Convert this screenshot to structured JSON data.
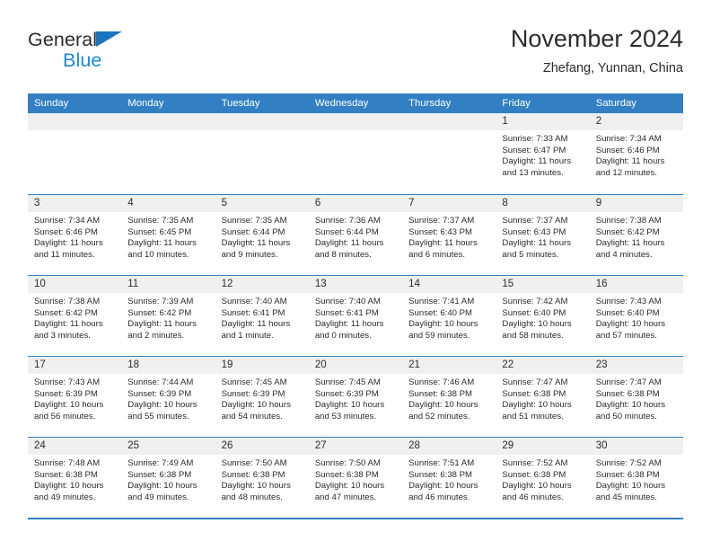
{
  "brand": {
    "name_top": "General",
    "name_bottom": "Blue",
    "accent_color": "#1b72bf",
    "blue_text_color": "#1b87e0"
  },
  "header": {
    "title": "November 2024",
    "subtitle": "Zhefang, Yunnan, China"
  },
  "theme": {
    "header_blue": "#3280c3",
    "day_head_gray": "#f0f0f0",
    "text_color": "#2b2b2b"
  },
  "weekdays": [
    "Sunday",
    "Monday",
    "Tuesday",
    "Wednesday",
    "Thursday",
    "Friday",
    "Saturday"
  ],
  "weeks": [
    [
      {
        "day": "",
        "sunrise": "",
        "sunset": "",
        "daylight1": "",
        "daylight2": ""
      },
      {
        "day": "",
        "sunrise": "",
        "sunset": "",
        "daylight1": "",
        "daylight2": ""
      },
      {
        "day": "",
        "sunrise": "",
        "sunset": "",
        "daylight1": "",
        "daylight2": ""
      },
      {
        "day": "",
        "sunrise": "",
        "sunset": "",
        "daylight1": "",
        "daylight2": ""
      },
      {
        "day": "",
        "sunrise": "",
        "sunset": "",
        "daylight1": "",
        "daylight2": ""
      },
      {
        "day": "1",
        "sunrise": "Sunrise: 7:33 AM",
        "sunset": "Sunset: 6:47 PM",
        "daylight1": "Daylight: 11 hours",
        "daylight2": "and 13 minutes."
      },
      {
        "day": "2",
        "sunrise": "Sunrise: 7:34 AM",
        "sunset": "Sunset: 6:46 PM",
        "daylight1": "Daylight: 11 hours",
        "daylight2": "and 12 minutes."
      }
    ],
    [
      {
        "day": "3",
        "sunrise": "Sunrise: 7:34 AM",
        "sunset": "Sunset: 6:46 PM",
        "daylight1": "Daylight: 11 hours",
        "daylight2": "and 11 minutes."
      },
      {
        "day": "4",
        "sunrise": "Sunrise: 7:35 AM",
        "sunset": "Sunset: 6:45 PM",
        "daylight1": "Daylight: 11 hours",
        "daylight2": "and 10 minutes."
      },
      {
        "day": "5",
        "sunrise": "Sunrise: 7:35 AM",
        "sunset": "Sunset: 6:44 PM",
        "daylight1": "Daylight: 11 hours",
        "daylight2": "and 9 minutes."
      },
      {
        "day": "6",
        "sunrise": "Sunrise: 7:36 AM",
        "sunset": "Sunset: 6:44 PM",
        "daylight1": "Daylight: 11 hours",
        "daylight2": "and 8 minutes."
      },
      {
        "day": "7",
        "sunrise": "Sunrise: 7:37 AM",
        "sunset": "Sunset: 6:43 PM",
        "daylight1": "Daylight: 11 hours",
        "daylight2": "and 6 minutes."
      },
      {
        "day": "8",
        "sunrise": "Sunrise: 7:37 AM",
        "sunset": "Sunset: 6:43 PM",
        "daylight1": "Daylight: 11 hours",
        "daylight2": "and 5 minutes."
      },
      {
        "day": "9",
        "sunrise": "Sunrise: 7:38 AM",
        "sunset": "Sunset: 6:42 PM",
        "daylight1": "Daylight: 11 hours",
        "daylight2": "and 4 minutes."
      }
    ],
    [
      {
        "day": "10",
        "sunrise": "Sunrise: 7:38 AM",
        "sunset": "Sunset: 6:42 PM",
        "daylight1": "Daylight: 11 hours",
        "daylight2": "and 3 minutes."
      },
      {
        "day": "11",
        "sunrise": "Sunrise: 7:39 AM",
        "sunset": "Sunset: 6:42 PM",
        "daylight1": "Daylight: 11 hours",
        "daylight2": "and 2 minutes."
      },
      {
        "day": "12",
        "sunrise": "Sunrise: 7:40 AM",
        "sunset": "Sunset: 6:41 PM",
        "daylight1": "Daylight: 11 hours",
        "daylight2": "and 1 minute."
      },
      {
        "day": "13",
        "sunrise": "Sunrise: 7:40 AM",
        "sunset": "Sunset: 6:41 PM",
        "daylight1": "Daylight: 11 hours",
        "daylight2": "and 0 minutes."
      },
      {
        "day": "14",
        "sunrise": "Sunrise: 7:41 AM",
        "sunset": "Sunset: 6:40 PM",
        "daylight1": "Daylight: 10 hours",
        "daylight2": "and 59 minutes."
      },
      {
        "day": "15",
        "sunrise": "Sunrise: 7:42 AM",
        "sunset": "Sunset: 6:40 PM",
        "daylight1": "Daylight: 10 hours",
        "daylight2": "and 58 minutes."
      },
      {
        "day": "16",
        "sunrise": "Sunrise: 7:43 AM",
        "sunset": "Sunset: 6:40 PM",
        "daylight1": "Daylight: 10 hours",
        "daylight2": "and 57 minutes."
      }
    ],
    [
      {
        "day": "17",
        "sunrise": "Sunrise: 7:43 AM",
        "sunset": "Sunset: 6:39 PM",
        "daylight1": "Daylight: 10 hours",
        "daylight2": "and 56 minutes."
      },
      {
        "day": "18",
        "sunrise": "Sunrise: 7:44 AM",
        "sunset": "Sunset: 6:39 PM",
        "daylight1": "Daylight: 10 hours",
        "daylight2": "and 55 minutes."
      },
      {
        "day": "19",
        "sunrise": "Sunrise: 7:45 AM",
        "sunset": "Sunset: 6:39 PM",
        "daylight1": "Daylight: 10 hours",
        "daylight2": "and 54 minutes."
      },
      {
        "day": "20",
        "sunrise": "Sunrise: 7:45 AM",
        "sunset": "Sunset: 6:39 PM",
        "daylight1": "Daylight: 10 hours",
        "daylight2": "and 53 minutes."
      },
      {
        "day": "21",
        "sunrise": "Sunrise: 7:46 AM",
        "sunset": "Sunset: 6:38 PM",
        "daylight1": "Daylight: 10 hours",
        "daylight2": "and 52 minutes."
      },
      {
        "day": "22",
        "sunrise": "Sunrise: 7:47 AM",
        "sunset": "Sunset: 6:38 PM",
        "daylight1": "Daylight: 10 hours",
        "daylight2": "and 51 minutes."
      },
      {
        "day": "23",
        "sunrise": "Sunrise: 7:47 AM",
        "sunset": "Sunset: 6:38 PM",
        "daylight1": "Daylight: 10 hours",
        "daylight2": "and 50 minutes."
      }
    ],
    [
      {
        "day": "24",
        "sunrise": "Sunrise: 7:48 AM",
        "sunset": "Sunset: 6:38 PM",
        "daylight1": "Daylight: 10 hours",
        "daylight2": "and 49 minutes."
      },
      {
        "day": "25",
        "sunrise": "Sunrise: 7:49 AM",
        "sunset": "Sunset: 6:38 PM",
        "daylight1": "Daylight: 10 hours",
        "daylight2": "and 49 minutes."
      },
      {
        "day": "26",
        "sunrise": "Sunrise: 7:50 AM",
        "sunset": "Sunset: 6:38 PM",
        "daylight1": "Daylight: 10 hours",
        "daylight2": "and 48 minutes."
      },
      {
        "day": "27",
        "sunrise": "Sunrise: 7:50 AM",
        "sunset": "Sunset: 6:38 PM",
        "daylight1": "Daylight: 10 hours",
        "daylight2": "and 47 minutes."
      },
      {
        "day": "28",
        "sunrise": "Sunrise: 7:51 AM",
        "sunset": "Sunset: 6:38 PM",
        "daylight1": "Daylight: 10 hours",
        "daylight2": "and 46 minutes."
      },
      {
        "day": "29",
        "sunrise": "Sunrise: 7:52 AM",
        "sunset": "Sunset: 6:38 PM",
        "daylight1": "Daylight: 10 hours",
        "daylight2": "and 46 minutes."
      },
      {
        "day": "30",
        "sunrise": "Sunrise: 7:52 AM",
        "sunset": "Sunset: 6:38 PM",
        "daylight1": "Daylight: 10 hours",
        "daylight2": "and 45 minutes."
      }
    ]
  ]
}
